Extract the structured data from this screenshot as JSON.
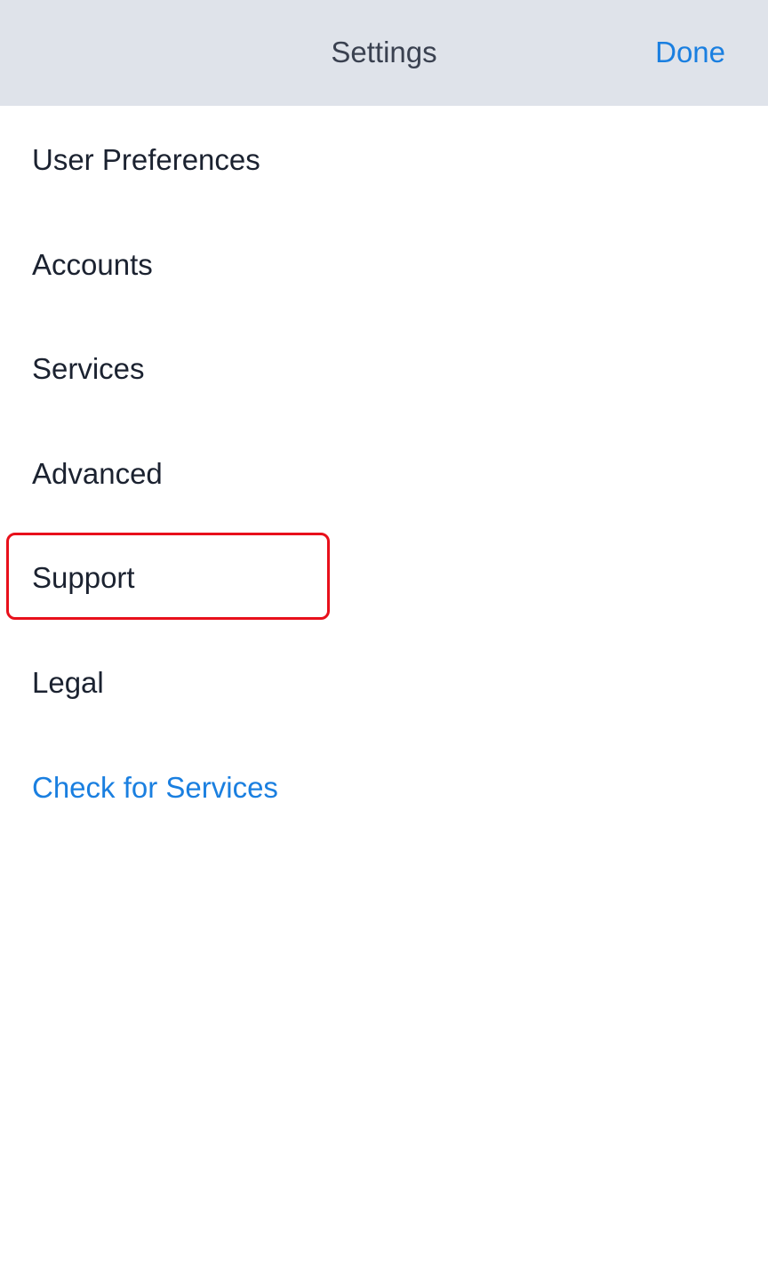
{
  "header": {
    "title": "Settings",
    "done_label": "Done"
  },
  "settings": {
    "items": [
      {
        "label": "User Preferences"
      },
      {
        "label": "Accounts"
      },
      {
        "label": "Services"
      },
      {
        "label": "Advanced"
      },
      {
        "label": "Support",
        "highlighted": true
      },
      {
        "label": "Legal"
      },
      {
        "label": "Check for Services",
        "style": "link"
      }
    ]
  },
  "colors": {
    "header_background": "#dfe3ea",
    "accent": "#1a7fe0",
    "highlight_border": "#e8101b",
    "text": "#1b2230"
  }
}
